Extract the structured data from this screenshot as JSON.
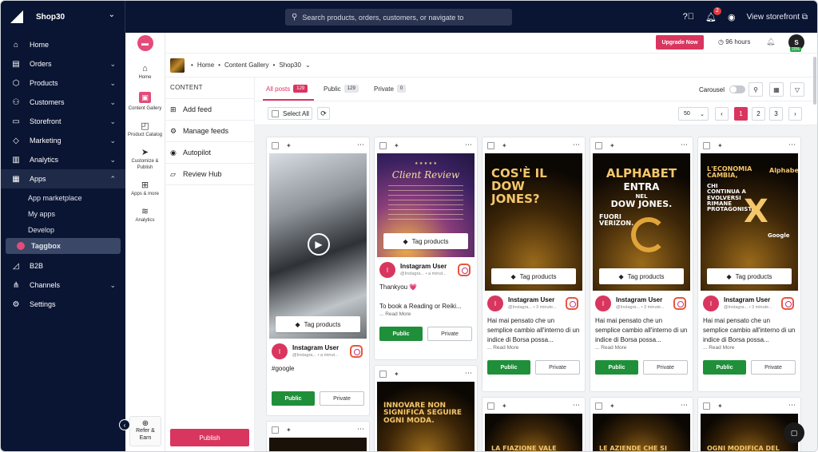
{
  "topbar": {
    "store_name": "Shop30",
    "search_placeholder": "Search products, orders, customers, or navigate to",
    "notification_count": "2",
    "view_storefront": "View storefront"
  },
  "leftnav": {
    "items": [
      {
        "label": "Home",
        "icon": "home-icon"
      },
      {
        "label": "Orders",
        "icon": "orders-icon"
      },
      {
        "label": "Products",
        "icon": "products-icon"
      },
      {
        "label": "Customers",
        "icon": "customers-icon"
      },
      {
        "label": "Storefront",
        "icon": "storefront-icon"
      },
      {
        "label": "Marketing",
        "icon": "marketing-icon"
      },
      {
        "label": "Analytics",
        "icon": "analytics-icon"
      },
      {
        "label": "Apps",
        "icon": "apps-icon"
      }
    ],
    "apps_sub": [
      "App marketplace",
      "My apps",
      "Develop",
      "Taggbox"
    ],
    "bottom": [
      {
        "label": "B2B"
      },
      {
        "label": "Channels"
      },
      {
        "label": "Settings"
      }
    ]
  },
  "rail": {
    "items": [
      "Home",
      "Content Gallery",
      "Product Catalog",
      "Customize & Publish",
      "Apps & more",
      "Analytics"
    ],
    "refer": "Refer & Earn"
  },
  "header": {
    "upgrade": "Upgrade Now",
    "hours": "96 hours",
    "avatar": "S",
    "avatar_badge": "20%"
  },
  "breadcrumb": [
    "Home",
    "Content Gallery",
    "Shop30"
  ],
  "content_panel": {
    "title": "CONTENT",
    "items": [
      "Add feed",
      "Manage feeds",
      "Autopilot",
      "Review Hub"
    ],
    "publish": "Publish"
  },
  "tabs": [
    {
      "label": "All posts",
      "count": "129"
    },
    {
      "label": "Public",
      "count": "129"
    },
    {
      "label": "Private",
      "count": "0"
    }
  ],
  "toolbar": {
    "carousel": "Carousel",
    "select_all": "Select All",
    "per_page": "50",
    "pages": [
      "1",
      "2",
      "3"
    ]
  },
  "cards": {
    "tag_products": "Tag products",
    "public": "Public",
    "private": "Private",
    "read_more": "... Read More",
    "user": "Instagram User",
    "handle1": "@Instagra... • a minut...",
    "handle3": "@Instagra... • 3 minute...",
    "c1_text": "#google",
    "c2_text1": "Thankyou 💗",
    "c2_text2": "To book a Reading or Reiki...",
    "c3_text": "Hai mai pensato che un semplice cambio all'interno di un indice di Borsa possa...",
    "c2_review": "Client Review",
    "c3_poster": "COS'È IL DOW JONES?",
    "c4_poster1": "ALPHABET",
    "c4_poster2": "ENTRA",
    "c4_poster3": "NEL",
    "c4_poster4": "DOW JONES.",
    "c4_poster5": "FUORI VERIZON.",
    "c5_poster1": "L'ECONOMIA CAMBIA,",
    "c5_poster2": "CHI CONTINUA A EVOLVERSI RIMANE PROTAGONISTA.",
    "c5_poster3": "Alphabet",
    "c5_poster4": "Google",
    "r2_1": "INNOVARE NON SIGNIFICA SEGUIRE OGNI MODA.",
    "r2_2": "LA FIAZIONE VALE ANCHE PER",
    "r2_3": "LE AZIENDE CHE SI ADATTANO CONTINUANO",
    "r2_4": "OGNI MODIFICA DEL DOW JONES RACCONTA"
  }
}
